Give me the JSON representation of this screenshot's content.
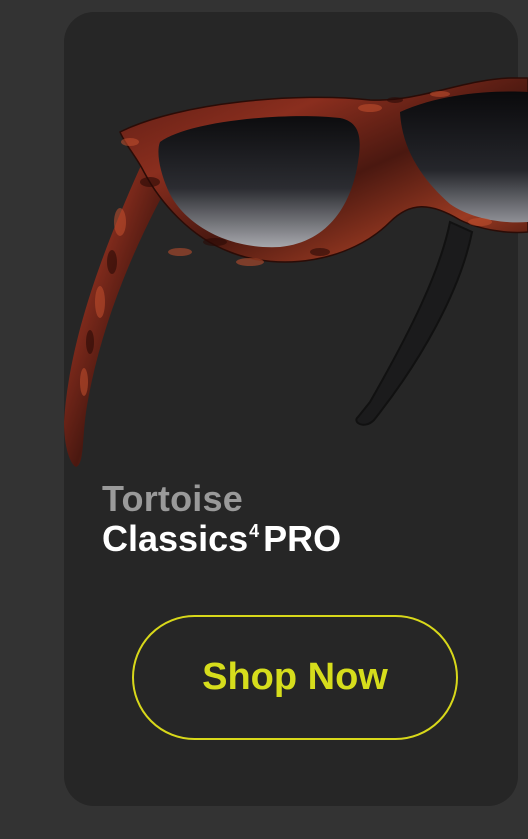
{
  "card": {
    "color_name": "Tortoise",
    "product_base": "Classics",
    "product_sup": "4",
    "product_suffix": "PRO",
    "button_label": "Shop Now"
  },
  "image": {
    "icon": "sunglasses-image"
  },
  "colors": {
    "page_bg": "#333333",
    "card_bg": "#262626",
    "accent": "#d6dd1c",
    "muted_text": "#9a9a9a",
    "primary_text": "#ffffff"
  }
}
